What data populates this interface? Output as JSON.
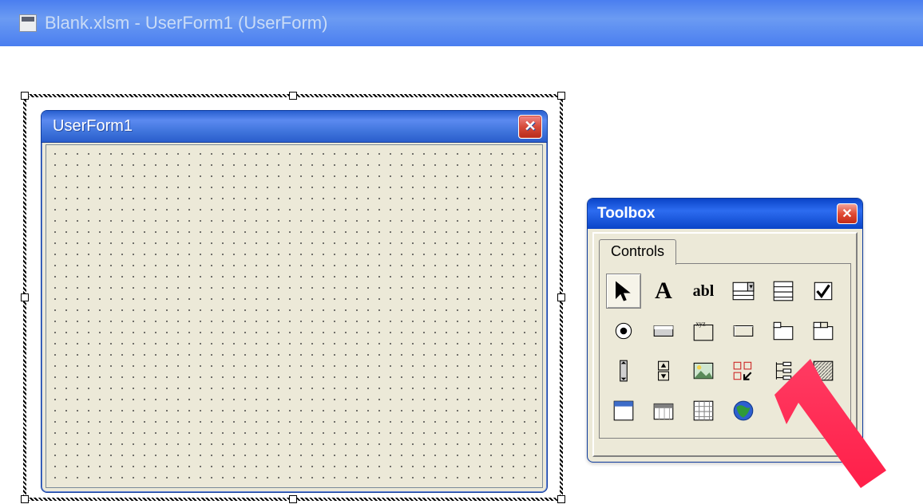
{
  "outer_window": {
    "title": "Blank.xlsm - UserForm1 (UserForm)"
  },
  "userform": {
    "title": "UserForm1"
  },
  "toolbox": {
    "title": "Toolbox",
    "tab_label": "Controls",
    "tools": [
      {
        "name": "select",
        "label": "Select Objects"
      },
      {
        "name": "label",
        "label": "Label (A)"
      },
      {
        "name": "textbox",
        "label": "TextBox (abl)"
      },
      {
        "name": "combobox",
        "label": "ComboBox"
      },
      {
        "name": "listbox",
        "label": "ListBox"
      },
      {
        "name": "checkbox",
        "label": "CheckBox"
      },
      {
        "name": "optionbutton",
        "label": "OptionButton"
      },
      {
        "name": "togglebutton",
        "label": "ToggleButton"
      },
      {
        "name": "frame",
        "label": "Frame (xyz)"
      },
      {
        "name": "commandbutton",
        "label": "CommandButton"
      },
      {
        "name": "tabstrip",
        "label": "TabStrip"
      },
      {
        "name": "multipage",
        "label": "MultiPage"
      },
      {
        "name": "scrollbar",
        "label": "ScrollBar"
      },
      {
        "name": "spinbutton",
        "label": "SpinButton"
      },
      {
        "name": "image",
        "label": "Image"
      },
      {
        "name": "refedit",
        "label": "RefEdit"
      },
      {
        "name": "treeview",
        "label": "TreeView"
      },
      {
        "name": "unknown",
        "label": "Unknown / Grid control"
      },
      {
        "name": "microsoftforms",
        "label": "Microsoft Forms Frame"
      },
      {
        "name": "datetimepicker",
        "label": "DateTimePicker"
      },
      {
        "name": "monthview",
        "label": "MonthView / Calendar"
      },
      {
        "name": "webbrowser",
        "label": "WebBrowser (globe)"
      }
    ]
  }
}
